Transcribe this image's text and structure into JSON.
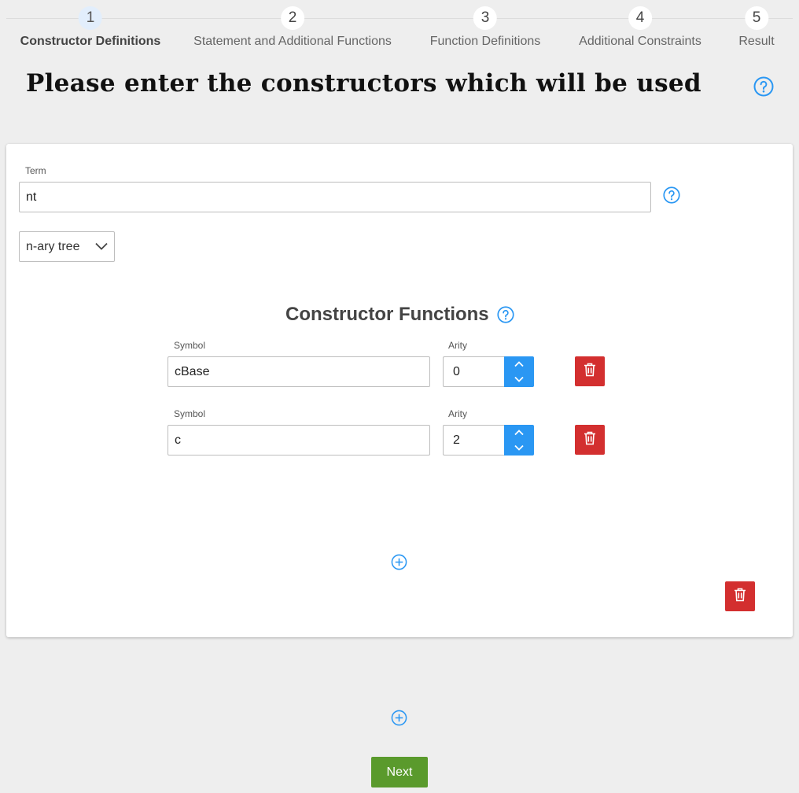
{
  "stepper": {
    "steps": [
      {
        "number": "1",
        "label": "Constructor Definitions"
      },
      {
        "number": "2",
        "label": "Statement and Additional Functions"
      },
      {
        "number": "3",
        "label": "Function Definitions"
      },
      {
        "number": "4",
        "label": "Additional Constraints"
      },
      {
        "number": "5",
        "label": "Result"
      }
    ],
    "active_step": "1"
  },
  "header": {
    "title": "Please enter the constructors which will be used"
  },
  "term": {
    "label": "Term",
    "value": "nt",
    "type_select": "n-ary tree"
  },
  "constructor_functions": {
    "title": "Constructor Functions",
    "rows": [
      {
        "symbol_label": "Symbol",
        "symbol": "cBase",
        "arity_label": "Arity",
        "arity": "0"
      },
      {
        "symbol_label": "Symbol",
        "symbol": "c",
        "arity_label": "Arity",
        "arity": "2"
      }
    ]
  },
  "footer": {
    "next_label": "Next"
  },
  "colors": {
    "accent_blue": "#2a97f3",
    "danger_red": "#d32f2f",
    "next_green": "#5a9a2c",
    "active_step_bg": "#e2eefc"
  }
}
